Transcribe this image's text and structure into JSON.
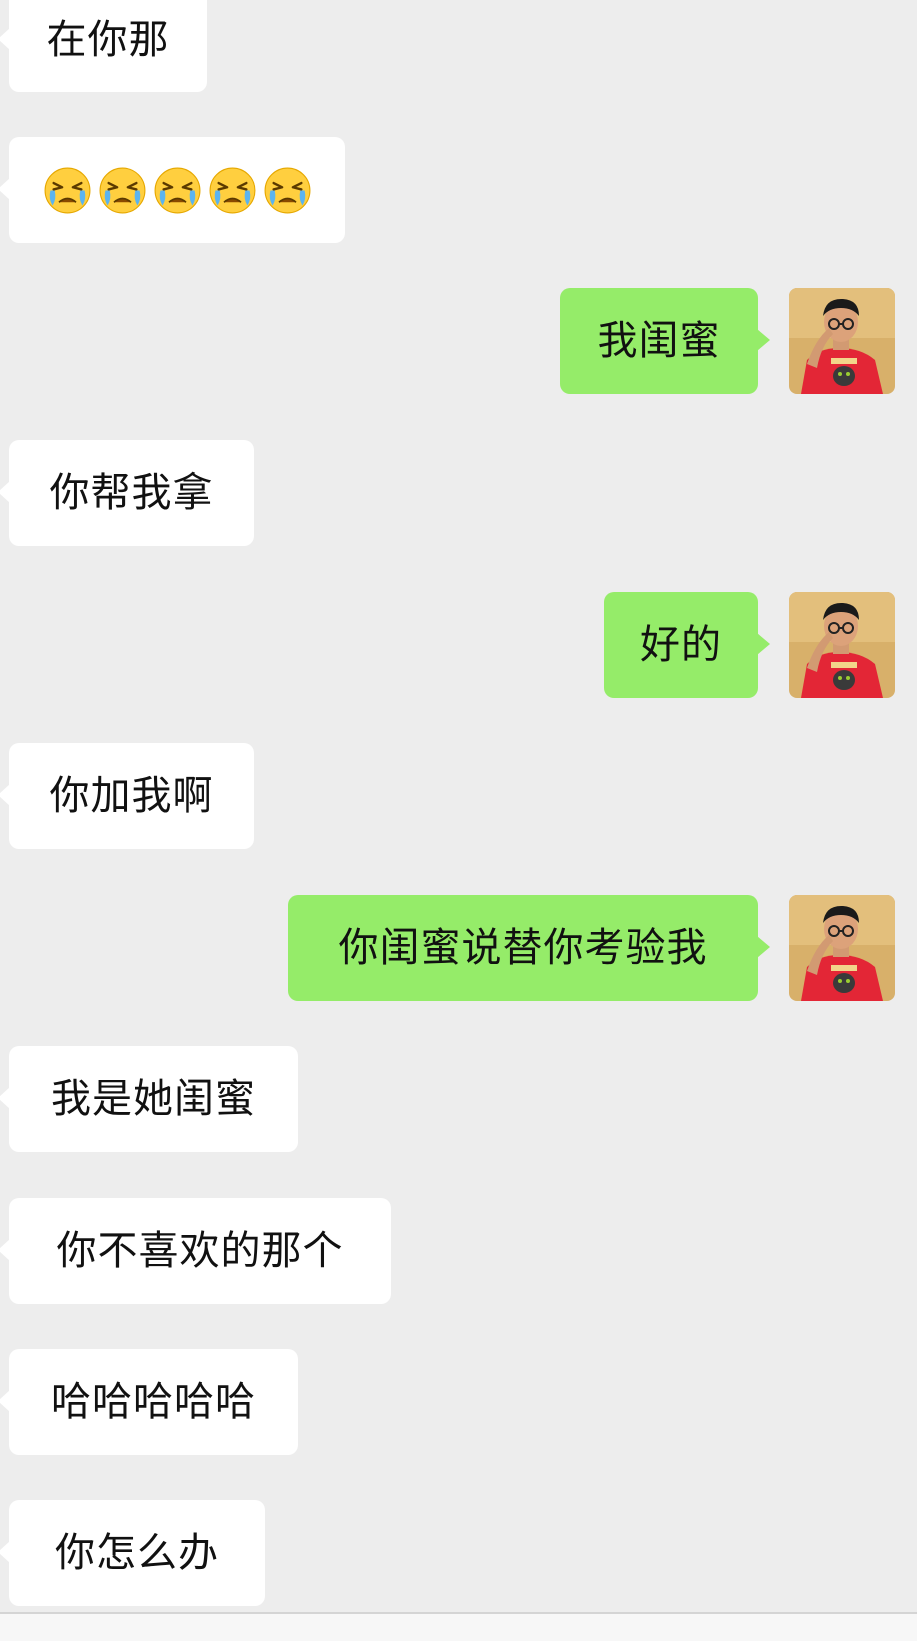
{
  "conversation": {
    "messages": [
      {
        "side": "in",
        "text": "在你那"
      },
      {
        "side": "in",
        "text": "",
        "emoji": [
          "crying-emoji",
          "crying-emoji",
          "crying-emoji",
          "crying-emoji",
          "crying-emoji"
        ]
      },
      {
        "side": "out",
        "text": "我闺蜜",
        "avatar": "user-avatar"
      },
      {
        "side": "in",
        "text": "你帮我拿"
      },
      {
        "side": "out",
        "text": "好的",
        "avatar": "user-avatar"
      },
      {
        "side": "in",
        "text": "你加我啊"
      },
      {
        "side": "out",
        "text": "你闺蜜说替你考验我",
        "avatar": "user-avatar"
      },
      {
        "side": "in",
        "text": "我是她闺蜜"
      },
      {
        "side": "in",
        "text": "你不喜欢的那个"
      },
      {
        "side": "in",
        "text": "哈哈哈哈哈"
      },
      {
        "side": "in",
        "text": "你怎么办"
      }
    ]
  },
  "colors": {
    "background": "#ededed",
    "incoming_bubble": "#ffffff",
    "outgoing_bubble": "#95ec69"
  }
}
